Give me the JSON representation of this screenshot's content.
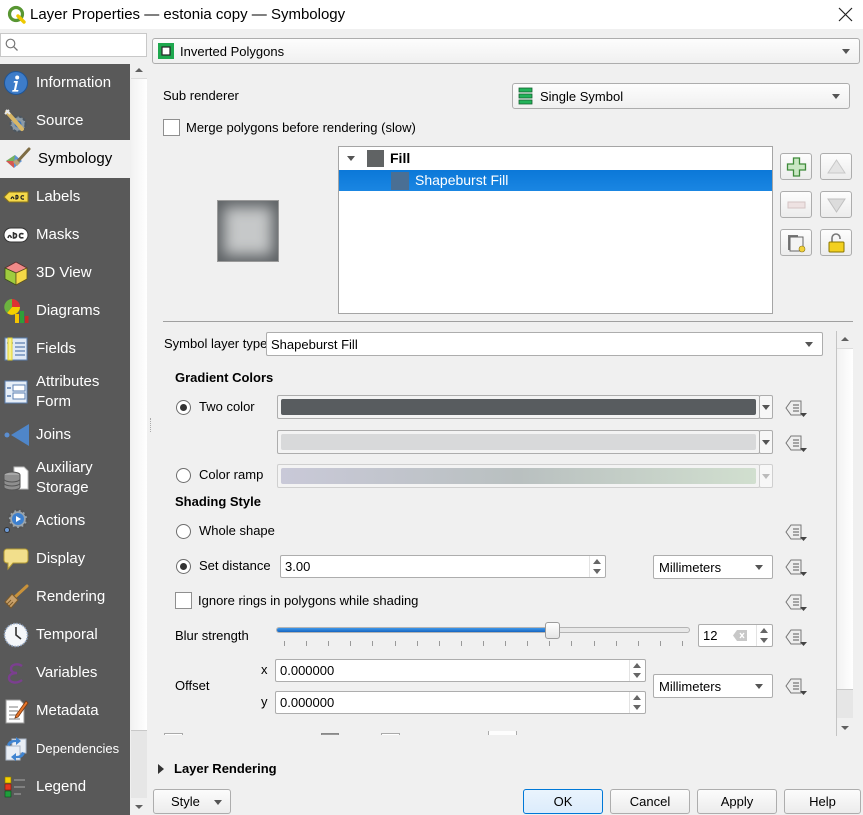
{
  "window": {
    "title": "Layer Properties — estonia copy — Symbology",
    "app_icon": "qgis-logo-icon",
    "close_icon": "close-icon"
  },
  "sidebar": {
    "search_value": "",
    "search_icon": "search-icon",
    "selected_index": 2,
    "items": [
      {
        "label": "Information",
        "icon": "information-icon"
      },
      {
        "label": "Source",
        "icon": "source-icon"
      },
      {
        "label": "Symbology",
        "icon": "symbology-icon"
      },
      {
        "label": "Labels",
        "icon": "labels-icon"
      },
      {
        "label": "Masks",
        "icon": "masks-icon"
      },
      {
        "label": "3D View",
        "icon": "3d-view-icon"
      },
      {
        "label": "Diagrams",
        "icon": "diagrams-icon"
      },
      {
        "label": "Fields",
        "icon": "fields-icon"
      },
      {
        "label": "Attributes Form",
        "icon": "attributes-form-icon"
      },
      {
        "label": "Joins",
        "icon": "joins-icon"
      },
      {
        "label": "Auxiliary Storage",
        "icon": "auxiliary-storage-icon"
      },
      {
        "label": "Actions",
        "icon": "actions-icon"
      },
      {
        "label": "Display",
        "icon": "display-icon"
      },
      {
        "label": "Rendering",
        "icon": "rendering-icon"
      },
      {
        "label": "Temporal",
        "icon": "temporal-icon"
      },
      {
        "label": "Variables",
        "icon": "variables-icon"
      },
      {
        "label": "Metadata",
        "icon": "metadata-icon"
      },
      {
        "label": "Dependencies",
        "icon": "dependencies-icon"
      },
      {
        "label": "Legend",
        "icon": "legend-icon"
      }
    ]
  },
  "renderer": {
    "selected": "Inverted Polygons",
    "icon": "inverted-polygons-icon"
  },
  "sub_renderer": {
    "label": "Sub renderer",
    "selected": "Single Symbol",
    "icon": "single-symbol-icon"
  },
  "merge_polygons": {
    "label": "Merge polygons before rendering (slow)",
    "checked": false
  },
  "symbol_tree": {
    "items": [
      {
        "label": "Fill",
        "level": 0,
        "expanded": true,
        "selected": false,
        "swatch": "#606364"
      },
      {
        "label": "Shapeburst Fill",
        "level": 1,
        "expanded": false,
        "selected": true,
        "swatch": "#4a6f94"
      }
    ],
    "buttons": {
      "add": {
        "icon": "add-layer-icon",
        "enabled": true
      },
      "move_up": {
        "icon": "move-up-icon",
        "enabled": false
      },
      "remove": {
        "icon": "remove-layer-icon",
        "enabled": false
      },
      "move_down": {
        "icon": "move-down-icon",
        "enabled": false
      },
      "duplicate": {
        "icon": "duplicate-layer-icon",
        "enabled": true
      },
      "lock": {
        "icon": "unlock-icon",
        "enabled": true
      }
    }
  },
  "symbol_layer_type": {
    "label": "Symbol layer type",
    "selected": "Shapeburst Fill"
  },
  "gradient_colors": {
    "title": "Gradient Colors",
    "two_color": {
      "label": "Two color",
      "checked": true
    },
    "color1": "#585c5f",
    "color2": "#d8d9da",
    "color_ramp": {
      "label": "Color ramp",
      "checked": false,
      "ramp_start": "#c9c9d8",
      "ramp_mid": "#b9c0c0",
      "ramp_end": "#d1dfcf"
    }
  },
  "shading_style": {
    "title": "Shading Style",
    "whole_shape": {
      "label": "Whole shape",
      "checked": false
    },
    "set_distance": {
      "label": "Set distance",
      "checked": true,
      "value": "3.00",
      "unit": "Millimeters"
    },
    "ignore_rings": {
      "label": "Ignore rings in polygons while shading",
      "checked": false
    }
  },
  "blur": {
    "label": "Blur strength",
    "value": 12,
    "value_text": "12",
    "min": 0,
    "max": 18
  },
  "offset": {
    "label": "Offset",
    "x_label": "x",
    "x_value": "0.000000",
    "y_label": "y",
    "y_value": "0.000000",
    "unit": "Millimeters"
  },
  "layer_rendering": {
    "label": "Layer Rendering",
    "expanded": false
  },
  "footer": {
    "style_label": "Style",
    "ok_label": "OK",
    "cancel_label": "Cancel",
    "apply_label": "Apply",
    "help_label": "Help"
  }
}
